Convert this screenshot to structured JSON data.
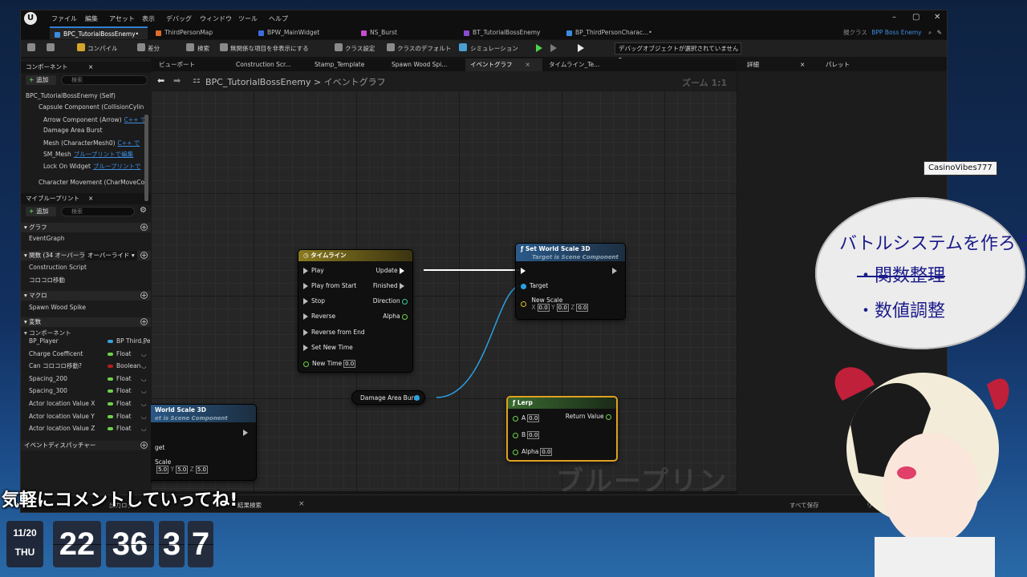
{
  "menubar": {
    "items": [
      "ファイル",
      "編集",
      "アセット",
      "表示",
      "デバッグ",
      "ウィンドウ",
      "ツール",
      "ヘルプ"
    ]
  },
  "doc_tabs": [
    {
      "label": "BPC_TutorialBossEnemy•",
      "active": true
    },
    {
      "label": "ThirdPersonMap"
    },
    {
      "label": "BPW_MainWidget"
    },
    {
      "label": "NS_Burst"
    },
    {
      "label": "BT_TutorialBossEnemy"
    },
    {
      "label": "BP_ThirdPersonCharac...•"
    }
  ],
  "parent_class": {
    "label": "親クラス",
    "value": "BPP Boss Enemy"
  },
  "toolbar": {
    "compile": "コンパイル",
    "diff": "差分",
    "find": "検索",
    "hide_unrelated": "無関係な項目を非表示にする",
    "class_settings": "クラス設定",
    "class_defaults": "クラスのデフォルト",
    "simulation": "シミュレーション",
    "debug_object": "デバッグオブジェクトが選択されていません"
  },
  "components_panel": {
    "title": "コンポーネント",
    "add": "追加",
    "search_placeholder": "検索",
    "items": [
      {
        "label": "BPC_TutorialBossEnemy (Self)"
      },
      {
        "label": "Capsule Component (CollisionCylin"
      },
      {
        "label": "Arrow Component (Arrow)",
        "tag": "C++ で"
      },
      {
        "label": "Damage Area Burst"
      },
      {
        "label": "Mesh (CharacterMesh0)",
        "tag": "C++ で"
      },
      {
        "label": "SM_Mesh",
        "tag": "ブループリントで編集"
      },
      {
        "label": "Lock On Widget",
        "tag": "ブループリントで"
      },
      {
        "label": "Character Movement (CharMoveCo"
      }
    ]
  },
  "my_blueprint": {
    "title": "マイブループリント",
    "add": "追加",
    "search_placeholder": "検索",
    "graph_head": "グラフ",
    "event_graph": "EventGraph",
    "functions_head": "関数 (34 オーバーライド",
    "override_dd": "オーバーライド",
    "functions": [
      "Construction Script",
      "コロコロ移動"
    ],
    "macros_head": "マクロ",
    "macros": [
      "Spawn Wood Spike"
    ],
    "vars_head": "変数",
    "components_head": "コンポーネント",
    "variables": [
      {
        "name": "BP_Player",
        "type": "BP Third Pe",
        "color": "#3aa0e0"
      },
      {
        "name": "Charge Coefficent",
        "type": "Float",
        "color": "#6fd24a"
      },
      {
        "name": "Can コロコロ移動?",
        "type": "Boolean",
        "color": "#b0201c"
      },
      {
        "name": "Spacing_200",
        "type": "Float",
        "color": "#6fd24a"
      },
      {
        "name": "Spacing_300",
        "type": "Float",
        "color": "#6fd24a"
      },
      {
        "name": "Actor location Value X",
        "type": "Float",
        "color": "#6fd24a"
      },
      {
        "name": "Actor location Value Y",
        "type": "Float",
        "color": "#6fd24a"
      },
      {
        "name": "Actor location Value Z",
        "type": "Float",
        "color": "#6fd24a"
      }
    ],
    "dispatchers_head": "イベントディスパッチャー"
  },
  "graph_tabs": [
    {
      "label": "ビューポート"
    },
    {
      "label": "Construction Scr..."
    },
    {
      "label": "Stamp_Template"
    },
    {
      "label": "Spawn Wood Spi..."
    },
    {
      "label": "イベントグラフ",
      "active": true
    },
    {
      "label": "タイムライン_Te..."
    }
  ],
  "breadcrumb": {
    "bp": "BPC_TutorialBossEnemy",
    "sep": ">",
    "graph": "イベントグラフ"
  },
  "zoom": "ズーム 1:1",
  "right_panel": {
    "details": "詳細",
    "palette": "パレット"
  },
  "nodes": {
    "timeline": {
      "title": "タイムライン",
      "inputs": [
        "Play",
        "Play from Start",
        "Stop",
        "Reverse",
        "Reverse from End",
        "Set New Time"
      ],
      "new_time_label": "New Time",
      "new_time_value": "0.0",
      "outputs": [
        "Update",
        "Finished",
        "Direction",
        "Alpha"
      ]
    },
    "set_world_scale": {
      "title": "Set World Scale 3D",
      "subtitle": "Target is Scene Component",
      "target": "Target",
      "new_scale": "New Scale",
      "x": "0.0",
      "y": "0.0",
      "z": "0.0"
    },
    "damage_area_burst": {
      "title": "Damage Area Burst"
    },
    "lerp": {
      "title": "Lerp",
      "a": "A",
      "a_val": "0.0",
      "b": "B",
      "b_val": "0.0",
      "alpha": "Alpha",
      "alpha_val": "0.0",
      "return": "Return Value"
    },
    "set_world_scale_2": {
      "title": "World Scale 3D",
      "subtitle": "et is Scene Component",
      "target": "get",
      "scale": "Scale",
      "x": "5.0",
      "y": "5.0",
      "z": "5.0"
    }
  },
  "graph_watermark": "ブループリント",
  "bottom_bar": {
    "find_results": "結果検索",
    "left_text": "出力ログ",
    "right_1": "すべて保存",
    "right_2": "リビジョン..."
  },
  "overlay": {
    "comment": "気軽にコメントしていってね!",
    "date": "11/20",
    "weekday": "THU",
    "hour": "22",
    "minute": "36",
    "sec_tens": "3",
    "sec_ones": "7"
  },
  "stream": {
    "username": "CasinoVibes777",
    "bubble_line1": "バトルシステムを作ろう",
    "bubble_line2": "・関数整理",
    "bubble_line3": "・数値調整"
  }
}
